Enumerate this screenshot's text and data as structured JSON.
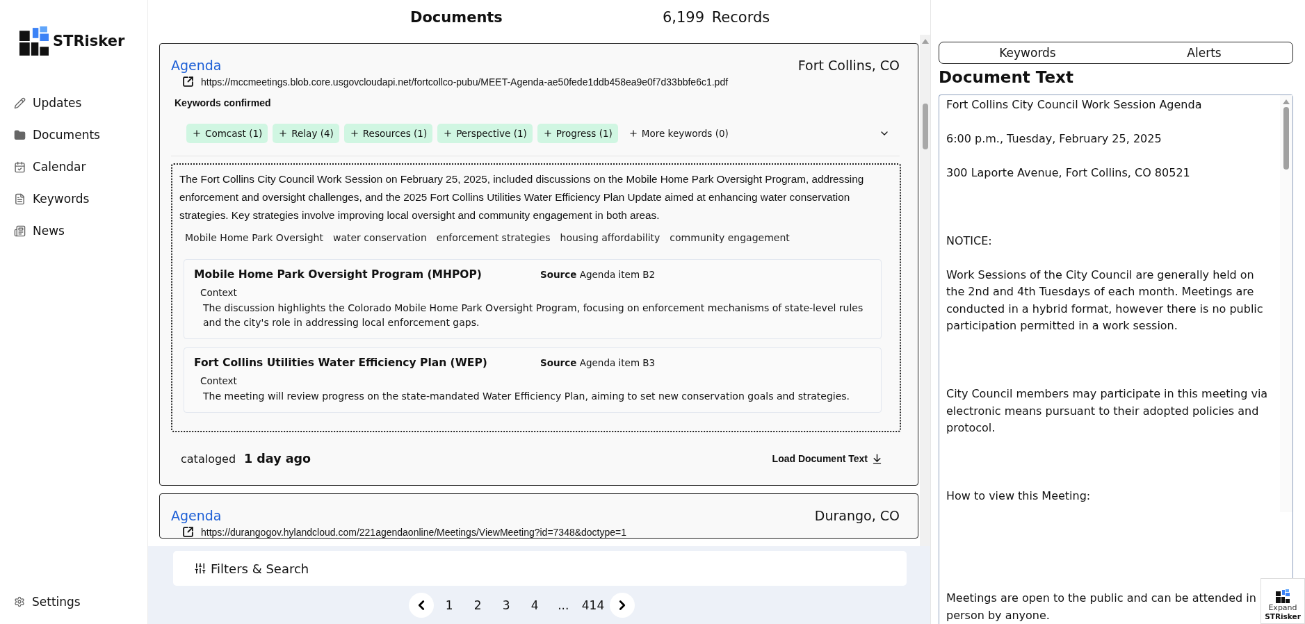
{
  "sidebar": {
    "brand": "STRisker",
    "items": [
      {
        "label": "Updates"
      },
      {
        "label": "Documents"
      },
      {
        "label": "Calendar"
      },
      {
        "label": "Keywords"
      },
      {
        "label": "News"
      }
    ],
    "settings": "Settings"
  },
  "header": {
    "title": "Documents",
    "count": "6,199",
    "count_label": "Records"
  },
  "documents": [
    {
      "type": "Agenda",
      "location": "Fort Collins, CO",
      "url": "https://mccmeetings.blob.core.usgovcloudapi.net/fortcollco-pubu/MEET-Agenda-ae50fede1ddb458ea9e0f7d33bbfe6c1.pdf",
      "keywords_heading": "Keywords confirmed",
      "keywords": [
        "Comcast (1)",
        "Relay (4)",
        "Resources (1)",
        "Perspective (1)",
        "Progress (1)"
      ],
      "more_keywords": "More keywords (0)",
      "summary": "The Fort Collins City Council Work Session on February 25, 2025, included discussions on the Mobile Home Park Oversight Program, addressing enforcement and oversight challenges, and the 2025 Fort Collins Utilities Water Efficiency Plan Update aimed at enhancing water conservation strategies. Key strategies involve improving local oversight and community engagement in both areas.",
      "topics": [
        "Mobile Home Park Oversight",
        "water conservation",
        "enforcement strategies",
        "housing affordability",
        "community engagement"
      ],
      "items": [
        {
          "title": "Mobile Home Park Oversight Program (MHPOP)",
          "source_label": "Source",
          "source": "Agenda item B2",
          "context_label": "Context",
          "context": "The discussion highlights the Colorado Mobile Home Park Oversight Program, focusing on enforcement mechanisms of state-level rules and the city's role in addressing local enforcement gaps."
        },
        {
          "title": "Fort Collins Utilities Water Efficiency Plan (WEP)",
          "source_label": "Source",
          "source": "Agenda item B3",
          "context_label": "Context",
          "context": "The meeting will review progress on the state-mandated Water Efficiency Plan, aiming to set new conservation goals and strategies."
        }
      ],
      "cataloged_label": "cataloged",
      "cataloged": "1 day ago",
      "load_text": "Load Document Text"
    },
    {
      "type": "Agenda",
      "location": "Durango, CO",
      "url": "https://durangogov.hylandcloud.com/221agendaonline/Meetings/ViewMeeting?id=7348&doctype=1"
    }
  ],
  "filters": {
    "label": "Filters & Search"
  },
  "pagination": {
    "pages": [
      "1",
      "2",
      "3",
      "4",
      "...",
      "414"
    ]
  },
  "right_panel": {
    "tabs": [
      {
        "label": "Keywords"
      },
      {
        "label": "Alerts"
      }
    ],
    "title": "Document Text",
    "text": "Fort Collins City Council Work Session Agenda\n\n6:00 p.m., Tuesday, February 25, 2025\n\n300 Laporte Avenue, Fort Collins, CO 80521\n\n\n\nNOTICE:\n\nWork Sessions of the City Council are generally held on the 2nd and 4th Tuesdays of each month. Meetings are conducted in a hybrid format, however there is no public participation permitted in a work session.\n\n\n\nCity Council members may participate in this meeting via electronic means pursuant to their adopted policies and protocol.\n\n\n\nHow to view this Meeting:\n\n\n\n\n\nMeetings are open to the public and can be attended in person by anyone."
  },
  "expand_widget": {
    "label": "Expand",
    "brand": "STRisker"
  }
}
